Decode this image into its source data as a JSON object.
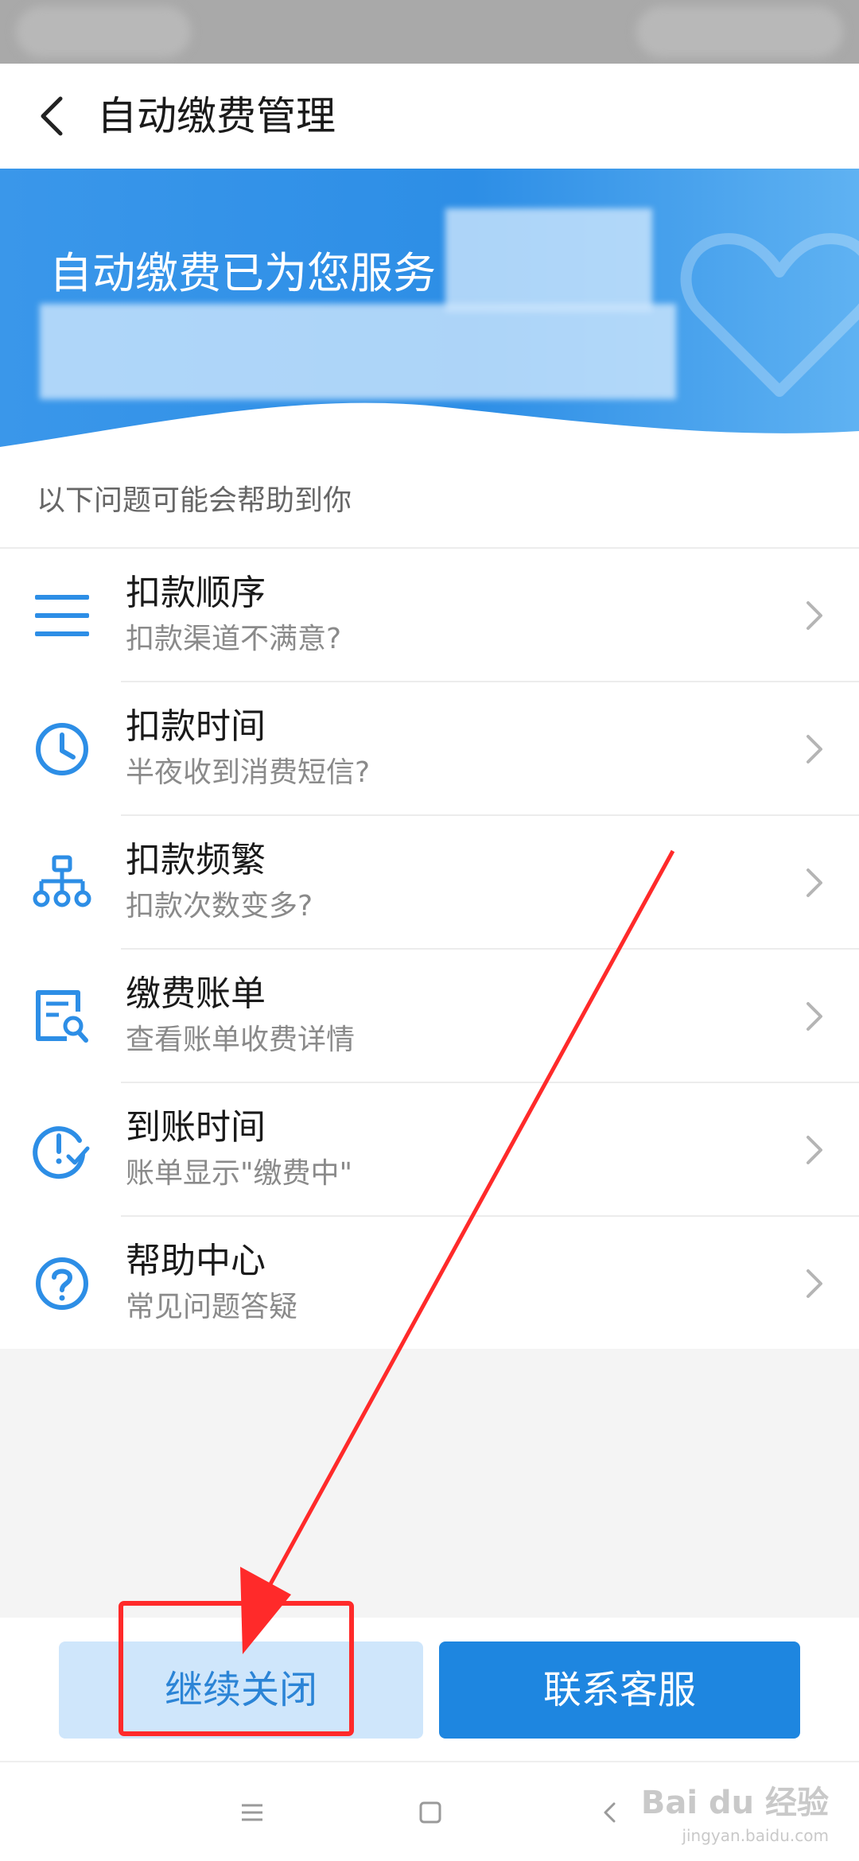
{
  "header": {
    "title": "自动缴费管理"
  },
  "banner": {
    "text": "自动缴费已为您服务"
  },
  "help": {
    "label": "以下问题可能会帮助到你"
  },
  "items": [
    {
      "title": "扣款顺序",
      "subtitle": "扣款渠道不满意?",
      "icon": "list-icon"
    },
    {
      "title": "扣款时间",
      "subtitle": "半夜收到消费短信?",
      "icon": "clock-icon"
    },
    {
      "title": "扣款频繁",
      "subtitle": "扣款次数变多?",
      "icon": "hierarchy-icon"
    },
    {
      "title": "缴费账单",
      "subtitle": "查看账单收费详情",
      "icon": "bill-search-icon"
    },
    {
      "title": "到账时间",
      "subtitle": "账单显示\"缴费中\"",
      "icon": "clock-check-icon"
    },
    {
      "title": "帮助中心",
      "subtitle": "常见问题答疑",
      "icon": "question-icon"
    }
  ],
  "buttons": {
    "continue_close": "继续关闭",
    "contact_service": "联系客服"
  },
  "watermark": {
    "brand": "Bai du 经验",
    "url": "jingyan.baidu.com"
  },
  "colors": {
    "accent": "#1e86e0",
    "banner": "#3a97ea",
    "annotation": "#ff2a2a"
  }
}
